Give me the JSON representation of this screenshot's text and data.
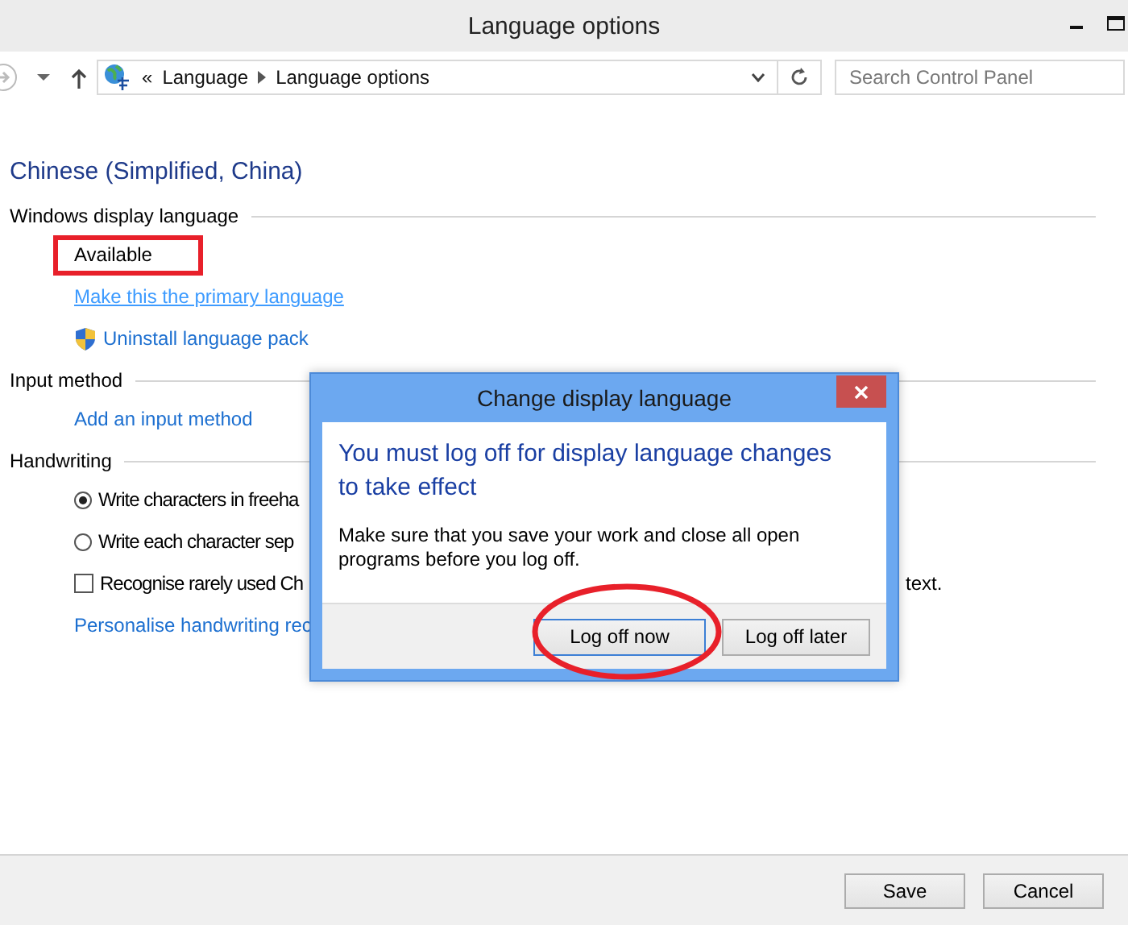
{
  "window": {
    "title": "Language options"
  },
  "address_bar": {
    "overflow": "«",
    "path": [
      "Language",
      "Language options"
    ]
  },
  "search": {
    "placeholder": "Search Control Panel"
  },
  "language": {
    "name": "Chinese (Simplified, China)"
  },
  "sections": [
    {
      "title": "Windows display language",
      "items": [
        {
          "kind": "status",
          "text": "Available",
          "highlighted": true
        },
        {
          "kind": "link",
          "text": "Make this the primary language",
          "hovered": true
        },
        {
          "kind": "shield-link",
          "text": "Uninstall language pack",
          "hovered": false
        }
      ]
    },
    {
      "title": "Input method",
      "items": [
        {
          "kind": "link",
          "text": "Add an input method",
          "hovered": false
        }
      ]
    },
    {
      "title": "Handwriting",
      "items": [
        {
          "kind": "radio",
          "text": "Write characters in freeha",
          "selected": true
        },
        {
          "kind": "radio",
          "text": "Write each character sep",
          "selected": false
        },
        {
          "kind": "checkbox",
          "text": "Recognise rarely used Ch",
          "trailing": "text.",
          "checked": false
        },
        {
          "kind": "link",
          "text": "Personalise handwriting rec",
          "hovered": false
        }
      ]
    }
  ],
  "footer_buttons": [
    "Save",
    "Cancel"
  ],
  "dialog": {
    "title": "Change display language",
    "heading": "You must log off for display language changes to take effect",
    "message": "Make sure that you save your work and close all open programs before you log off.",
    "buttons": [
      {
        "label": "Log off now",
        "focused": true,
        "highlighted": true
      },
      {
        "label": "Log off later",
        "focused": false,
        "highlighted": false
      }
    ]
  }
}
